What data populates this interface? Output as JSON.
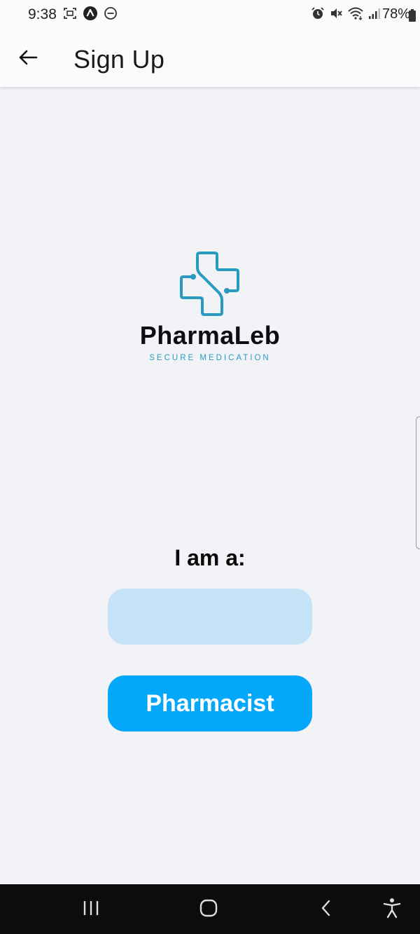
{
  "status_bar": {
    "time": "9:38",
    "battery_text": "78%",
    "left_icons": [
      "screen-record-icon",
      "app-notification-icon",
      "do-not-disturb-icon"
    ],
    "right_icons": [
      "alarm-icon",
      "mute-icon",
      "wifi-icon",
      "signal-icon",
      "battery-icon"
    ]
  },
  "app_bar": {
    "title": "Sign Up",
    "back_icon": "back-arrow-icon"
  },
  "logo": {
    "brand_name": "PharmaLeb",
    "tagline": "SECURE MEDICATION",
    "accent_color": "#2a9bc0"
  },
  "role_selection": {
    "heading": "I am a:",
    "buttons": [
      {
        "label": "",
        "state": "faded",
        "color": "#c4e3f7"
      },
      {
        "label": "Pharmacist",
        "state": "active",
        "color": "#05a7fb"
      }
    ]
  },
  "nav_bar": {
    "buttons": [
      "recent-apps-icon",
      "home-icon",
      "back-icon",
      "accessibility-icon"
    ]
  }
}
